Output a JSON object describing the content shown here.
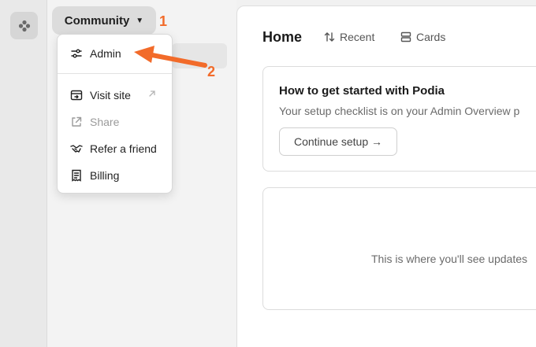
{
  "sidebar": {
    "workspace_label": "Community"
  },
  "menu": {
    "items": [
      {
        "label": "Admin",
        "icon": "sliders-icon"
      },
      {
        "label": "Visit site",
        "icon": "browser-icon"
      },
      {
        "label": "Share",
        "icon": "share-icon",
        "disabled": true
      },
      {
        "label": "Refer a friend",
        "icon": "handshake-icon"
      },
      {
        "label": "Billing",
        "icon": "receipt-icon"
      }
    ]
  },
  "main": {
    "title": "Home",
    "tabs": [
      {
        "label": "Recent",
        "icon": "sort-icon"
      },
      {
        "label": "Cards",
        "icon": "cards-icon"
      }
    ],
    "setup_card": {
      "title": "How to get started with Podia",
      "text": "Your setup checklist is on your Admin Overview p",
      "button_label": "Continue setup →"
    },
    "updates_card": {
      "text": "This is where you'll see updates"
    }
  },
  "annotations": {
    "step1": "1",
    "step2": "2",
    "color": "#f26b2a"
  }
}
